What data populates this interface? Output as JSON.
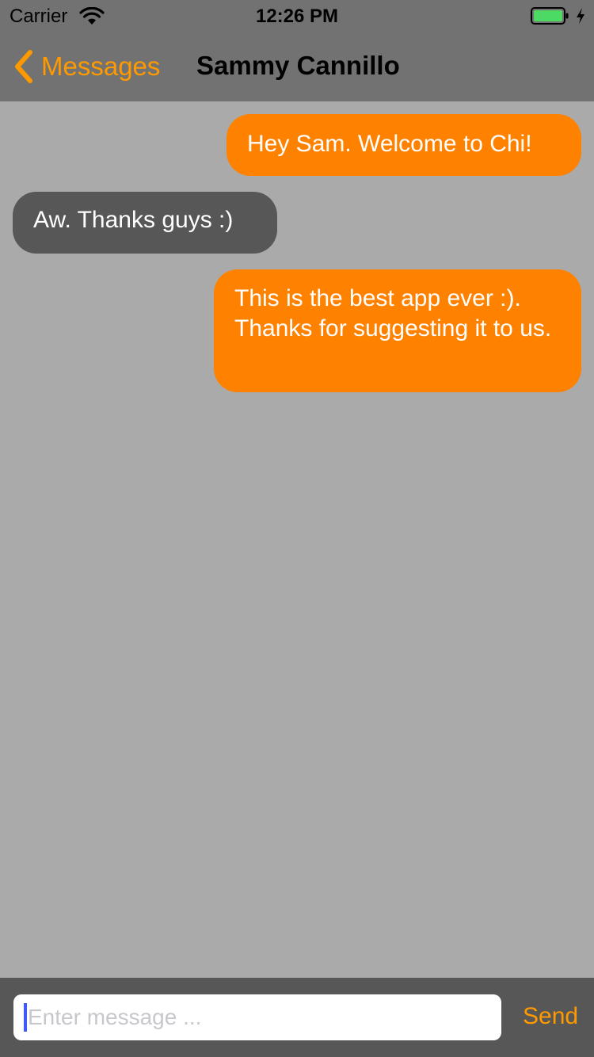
{
  "status_bar": {
    "carrier": "Carrier",
    "time": "12:26 PM",
    "battery_color": "#4cd964"
  },
  "nav": {
    "back_label": "Messages",
    "title": "Sammy Cannillo"
  },
  "messages": [
    {
      "direction": "outgoing",
      "text": "Hey Sam. Welcome to Chi!"
    },
    {
      "direction": "incoming",
      "text": "Aw. Thanks guys :)"
    },
    {
      "direction": "outgoing",
      "text": "This is the best app ever :). Thanks for suggesting it to us."
    }
  ],
  "composer": {
    "placeholder": "Enter message ...",
    "value": "",
    "send_label": "Send"
  },
  "colors": {
    "accent": "#ff9900",
    "outgoing_bubble": "#ff8100",
    "incoming_bubble": "#575757",
    "background": "#aaaaaa",
    "nav_background": "#727272"
  }
}
